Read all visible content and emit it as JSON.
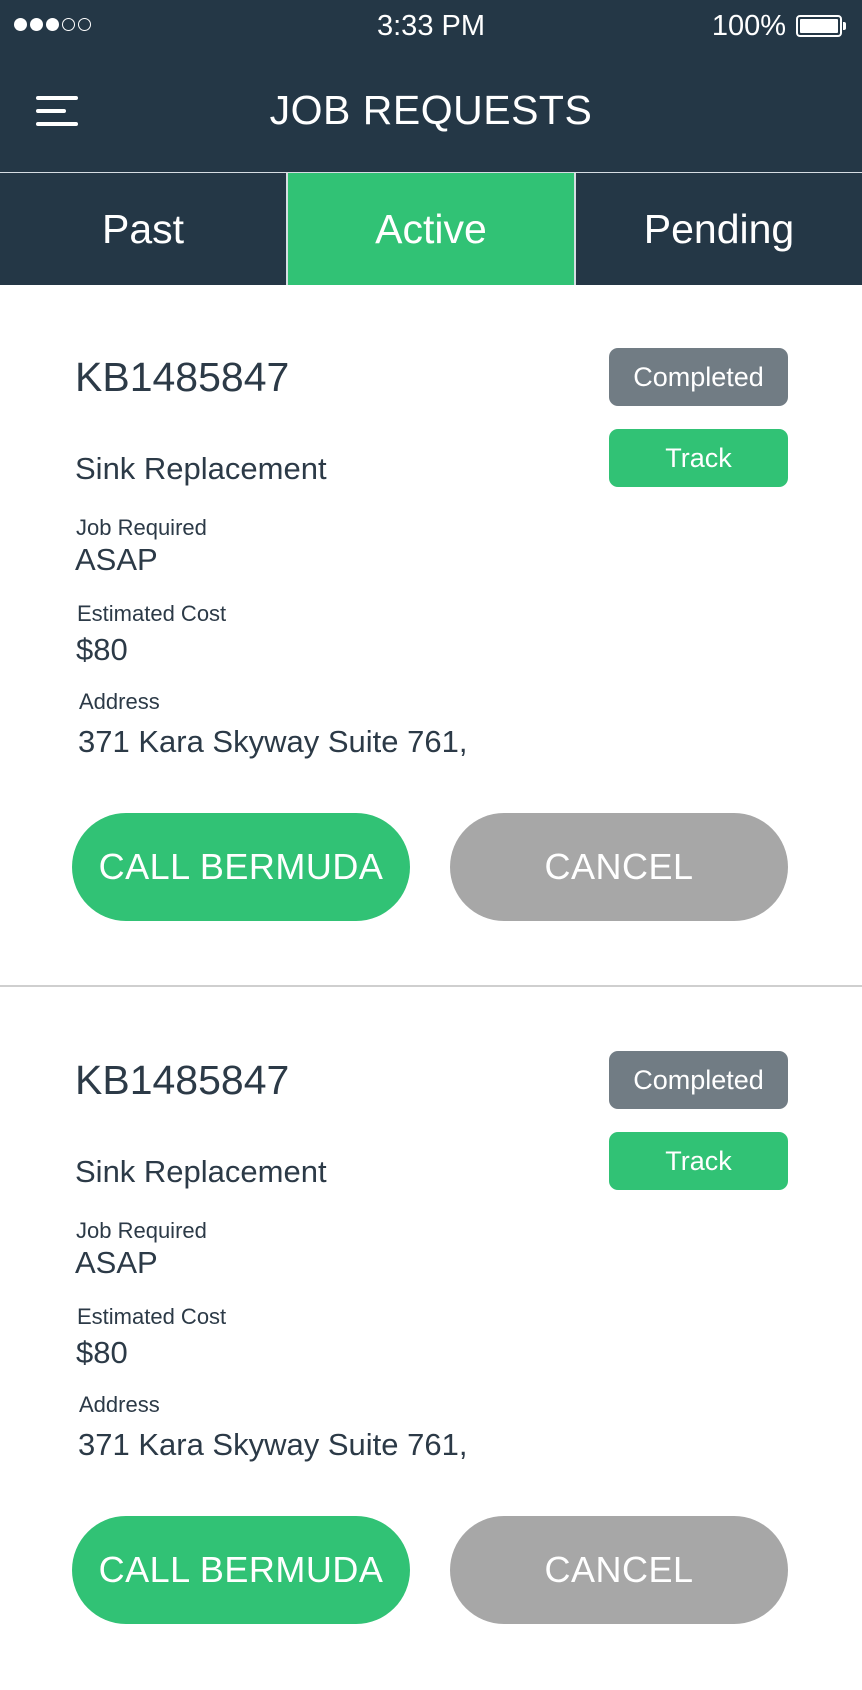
{
  "status_bar": {
    "signal_full": 3,
    "signal_empty": 2,
    "time": "3:33 PM",
    "battery_percent": "100%",
    "battery_icon": "battery-full-icon"
  },
  "header": {
    "menu_icon": "hamburger-menu-icon",
    "title": "JOB REQUESTS"
  },
  "tabs": [
    {
      "label": "Past",
      "active": false
    },
    {
      "label": "Active",
      "active": true
    },
    {
      "label": "Pending",
      "active": false
    }
  ],
  "jobs": [
    {
      "id": "KB1485847",
      "status": "Completed",
      "track_label": "Track",
      "service": "Sink Replacement",
      "job_required_label": "Job Required",
      "job_required_value": "ASAP",
      "cost_label": "Estimated Cost",
      "cost_value": "$80",
      "address_label": "Address",
      "address_value": "371 Kara Skyway Suite 761,",
      "call_label": "CALL BERMUDA",
      "cancel_label": "CANCEL"
    },
    {
      "id": "KB1485847",
      "status": "Completed",
      "track_label": "Track",
      "service": "Sink Replacement",
      "job_required_label": "Job Required",
      "job_required_value": "ASAP",
      "cost_label": "Estimated Cost",
      "cost_value": "$80",
      "address_label": "Address",
      "address_value": "371 Kara Skyway Suite 761,",
      "call_label": "CALL BERMUDA",
      "cancel_label": "CANCEL"
    }
  ],
  "colors": {
    "header_bg": "#243746",
    "accent_green": "#31c275",
    "badge_gray": "#717c84",
    "cancel_gray": "#a7a7a7"
  }
}
